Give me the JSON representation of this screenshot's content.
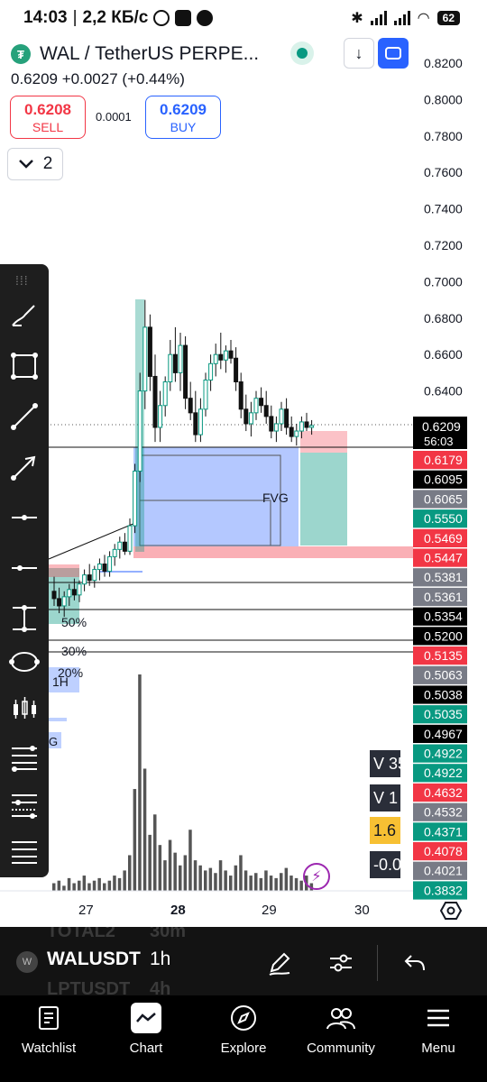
{
  "status_bar": {
    "time": "14:03",
    "speed": "2,2 КБ/с",
    "battery": "62"
  },
  "header": {
    "symbol_title": "WAL / TetherUS PERPE...",
    "last_price": "0.6209",
    "change": "+0.0027",
    "change_pct": "(+0.44%)",
    "sell_price": "0.6208",
    "sell_label": "SELL",
    "spread": "0.0001",
    "buy_price": "0.6209",
    "buy_label": "BUY",
    "collapse_count": "2",
    "down_glyph": "↓",
    "token_glyph": "₮"
  },
  "chart_data": {
    "type": "candlestick",
    "price_scale": [
      "0.8200",
      "0.8000",
      "0.7800",
      "0.7600",
      "0.7400",
      "0.7200",
      "0.7000",
      "0.6800",
      "0.6600",
      "0.6400"
    ],
    "ylim": [
      0.38,
      0.82
    ],
    "x_ticks": [
      "27",
      "28",
      "29",
      "30"
    ],
    "current_price": "0.6209",
    "countdown": "56:03",
    "price_tags": [
      {
        "label": "0.6179",
        "color": "#f23645"
      },
      {
        "label": "0.6095",
        "color": "#000000"
      },
      {
        "label": "0.6065",
        "color": "#787b86"
      },
      {
        "label": "0.5550",
        "color": "#089981"
      },
      {
        "label": "0.5469",
        "color": "#f23645"
      },
      {
        "label": "0.5447",
        "color": "#f23645"
      },
      {
        "label": "0.5381",
        "color": "#787b86"
      },
      {
        "label": "0.5361",
        "color": "#787b86"
      },
      {
        "label": "0.5354",
        "color": "#000000"
      },
      {
        "label": "0.5200",
        "color": "#000000"
      },
      {
        "label": "0.5135",
        "color": "#f23645"
      },
      {
        "label": "0.5063",
        "color": "#787b86"
      },
      {
        "label": "0.5038",
        "color": "#000000"
      },
      {
        "label": "0.5035",
        "color": "#089981"
      },
      {
        "label": "0.4967",
        "color": "#000000"
      },
      {
        "label": "0.4922",
        "color": "#089981"
      },
      {
        "label": "0.4922",
        "color": "#089981"
      },
      {
        "label": "0.4632",
        "color": "#f23645"
      },
      {
        "label": "0.4532",
        "color": "#787b86"
      },
      {
        "label": "0.4371",
        "color": "#089981"
      },
      {
        "label": "0.4078",
        "color": "#f23645"
      },
      {
        "label": "0.4021",
        "color": "#787b86"
      },
      {
        "label": "0.3832",
        "color": "#089981"
      }
    ],
    "annotations": [
      "FVG",
      "50%",
      "30%",
      "20%",
      "1H",
      "G"
    ],
    "candles": [
      [
        0.53,
        0.538,
        0.522,
        0.526
      ],
      [
        0.526,
        0.532,
        0.518,
        0.522
      ],
      [
        0.522,
        0.53,
        0.516,
        0.527
      ],
      [
        0.527,
        0.534,
        0.522,
        0.531
      ],
      [
        0.531,
        0.537,
        0.525,
        0.528
      ],
      [
        0.528,
        0.536,
        0.524,
        0.534
      ],
      [
        0.534,
        0.542,
        0.53,
        0.539
      ],
      [
        0.539,
        0.545,
        0.533,
        0.536
      ],
      [
        0.536,
        0.544,
        0.532,
        0.542
      ],
      [
        0.542,
        0.548,
        0.536,
        0.545
      ],
      [
        0.545,
        0.55,
        0.538,
        0.541
      ],
      [
        0.541,
        0.552,
        0.538,
        0.549
      ],
      [
        0.549,
        0.556,
        0.544,
        0.553
      ],
      [
        0.553,
        0.56,
        0.548,
        0.557
      ],
      [
        0.557,
        0.562,
        0.55,
        0.552
      ],
      [
        0.552,
        0.57,
        0.55,
        0.566
      ],
      [
        0.566,
        0.6,
        0.562,
        0.596
      ],
      [
        0.596,
        0.65,
        0.59,
        0.64
      ],
      [
        0.64,
        0.69,
        0.63,
        0.675
      ],
      [
        0.675,
        0.682,
        0.64,
        0.648
      ],
      [
        0.648,
        0.66,
        0.612,
        0.62
      ],
      [
        0.62,
        0.64,
        0.612,
        0.632
      ],
      [
        0.632,
        0.648,
        0.626,
        0.645
      ],
      [
        0.645,
        0.668,
        0.64,
        0.66
      ],
      [
        0.66,
        0.675,
        0.645,
        0.65
      ],
      [
        0.65,
        0.672,
        0.64,
        0.665
      ],
      [
        0.665,
        0.67,
        0.63,
        0.636
      ],
      [
        0.636,
        0.645,
        0.624,
        0.628
      ],
      [
        0.628,
        0.64,
        0.612,
        0.616
      ],
      [
        0.616,
        0.636,
        0.612,
        0.63
      ],
      [
        0.63,
        0.65,
        0.626,
        0.646
      ],
      [
        0.646,
        0.66,
        0.64,
        0.655
      ],
      [
        0.655,
        0.666,
        0.648,
        0.66
      ],
      [
        0.66,
        0.672,
        0.652,
        0.657
      ],
      [
        0.657,
        0.665,
        0.65,
        0.662
      ],
      [
        0.662,
        0.668,
        0.655,
        0.658
      ],
      [
        0.658,
        0.664,
        0.64,
        0.645
      ],
      [
        0.645,
        0.65,
        0.625,
        0.63
      ],
      [
        0.63,
        0.638,
        0.618,
        0.622
      ],
      [
        0.622,
        0.634,
        0.615,
        0.628
      ],
      [
        0.628,
        0.64,
        0.624,
        0.636
      ],
      [
        0.636,
        0.642,
        0.628,
        0.632
      ],
      [
        0.632,
        0.64,
        0.622,
        0.626
      ],
      [
        0.626,
        0.632,
        0.614,
        0.618
      ],
      [
        0.618,
        0.626,
        0.612,
        0.622
      ],
      [
        0.622,
        0.634,
        0.618,
        0.63
      ],
      [
        0.63,
        0.636,
        0.616,
        0.62
      ],
      [
        0.62,
        0.626,
        0.612,
        0.615
      ],
      [
        0.615,
        0.622,
        0.61,
        0.618
      ],
      [
        0.618,
        0.626,
        0.614,
        0.623
      ],
      [
        0.623,
        0.628,
        0.618,
        0.62
      ],
      [
        0.62,
        0.624,
        0.616,
        0.621
      ]
    ],
    "volume": [
      3,
      4,
      2,
      5,
      3,
      4,
      6,
      3,
      4,
      5,
      3,
      4,
      6,
      5,
      8,
      14,
      40,
      85,
      48,
      22,
      30,
      18,
      12,
      20,
      15,
      10,
      14,
      24,
      12,
      10,
      8,
      9,
      7,
      12,
      8,
      6,
      10,
      14,
      8,
      6,
      7,
      5,
      8,
      6,
      5,
      7,
      9,
      6,
      5,
      4,
      6,
      3
    ]
  },
  "overlay_boxes": [
    {
      "text": "V 35",
      "color": "#2a2e39"
    },
    {
      "text": "V 1",
      "color": "#2a2e39"
    },
    {
      "text": "1.6",
      "color": "#f7c033"
    },
    {
      "text": "-0.0",
      "color": "#2a2e39"
    }
  ],
  "toolbar": {
    "tools": [
      "brush-icon",
      "rectangle-icon",
      "trend-line-icon",
      "arrow-icon",
      "horizontal-ray-icon",
      "horizontal-line-icon",
      "price-range-icon",
      "ellipse-icon",
      "candles-icon",
      "fib-retracement-icon",
      "fib-extension-icon",
      "pitchfork-icon"
    ]
  },
  "symbol_strip": {
    "ghost_top": "TOTAL2",
    "ghost_top_interval": "30m",
    "symbol": "WALUSDT",
    "interval": "1h",
    "ghost_bottom": "LPTUSDT",
    "ghost_bottom_interval": "4h",
    "avatar": "W"
  },
  "bottom_nav": {
    "items": [
      {
        "label": "Watchlist",
        "icon": "watchlist-icon"
      },
      {
        "label": "Chart",
        "icon": "chart-icon"
      },
      {
        "label": "Explore",
        "icon": "compass-icon"
      },
      {
        "label": "Community",
        "icon": "community-icon"
      },
      {
        "label": "Menu",
        "icon": "menu-icon"
      }
    ]
  }
}
